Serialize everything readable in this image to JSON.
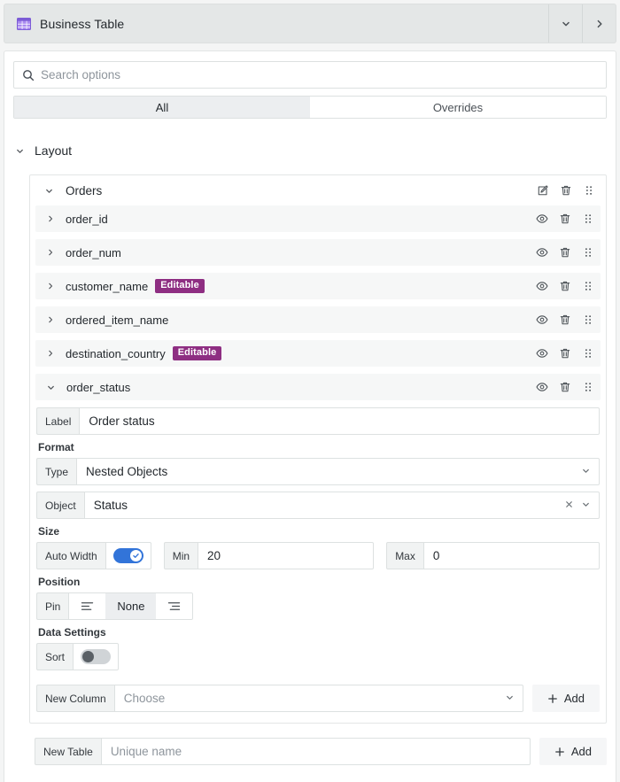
{
  "panel": {
    "title": "Business Table",
    "icon": "table-icon",
    "collapse_icon": "chevron-down-icon",
    "expand_icon": "chevron-right-icon"
  },
  "search": {
    "placeholder": "Search options",
    "value": "",
    "icon": "search-icon"
  },
  "tabs": [
    {
      "label": "All",
      "active": true
    },
    {
      "label": "Overrides",
      "active": false
    }
  ],
  "section": {
    "title": "Layout",
    "expanded": true
  },
  "group": {
    "name": "Orders",
    "expanded": true,
    "actions": [
      "edit-icon",
      "trash-icon",
      "drag-handle-icon"
    ],
    "fields": [
      {
        "name": "order_id",
        "badge": "",
        "expanded": false
      },
      {
        "name": "order_num",
        "badge": "",
        "expanded": false
      },
      {
        "name": "customer_name",
        "badge": "Editable",
        "expanded": false
      },
      {
        "name": "ordered_item_name",
        "badge": "",
        "expanded": false
      },
      {
        "name": "destination_country",
        "badge": "Editable",
        "expanded": false
      },
      {
        "name": "order_status",
        "badge": "",
        "expanded": true
      }
    ],
    "row_actions": [
      "eye-icon",
      "trash-icon",
      "drag-handle-icon"
    ]
  },
  "detail": {
    "label_prefix": "Label",
    "label_value": "Order status",
    "format_heading": "Format",
    "type_prefix": "Type",
    "type_value": "Nested Objects",
    "object_prefix": "Object",
    "object_value": "Status",
    "size_heading": "Size",
    "auto_width_prefix": "Auto Width",
    "auto_width_on": true,
    "min_prefix": "Min",
    "min_value": "20",
    "max_prefix": "Max",
    "max_value": "0",
    "position_heading": "Position",
    "pin_prefix": "Pin",
    "pin_options": [
      "align-left-icon",
      "None",
      "align-right-icon"
    ],
    "pin_selected": "None",
    "data_settings_heading": "Data Settings",
    "sort_prefix": "Sort",
    "sort_on": false
  },
  "new_column": {
    "prefix": "New Column",
    "placeholder": "Choose",
    "value": "",
    "add_label": "Add"
  },
  "new_table": {
    "prefix": "New Table",
    "placeholder": "Unique name",
    "value": "",
    "add_label": "Add"
  },
  "colors": {
    "badge": "#8e2e82",
    "toggle_on": "#3274d9",
    "panel_header": "#e4e7e7",
    "row": "#f6f7f7"
  }
}
